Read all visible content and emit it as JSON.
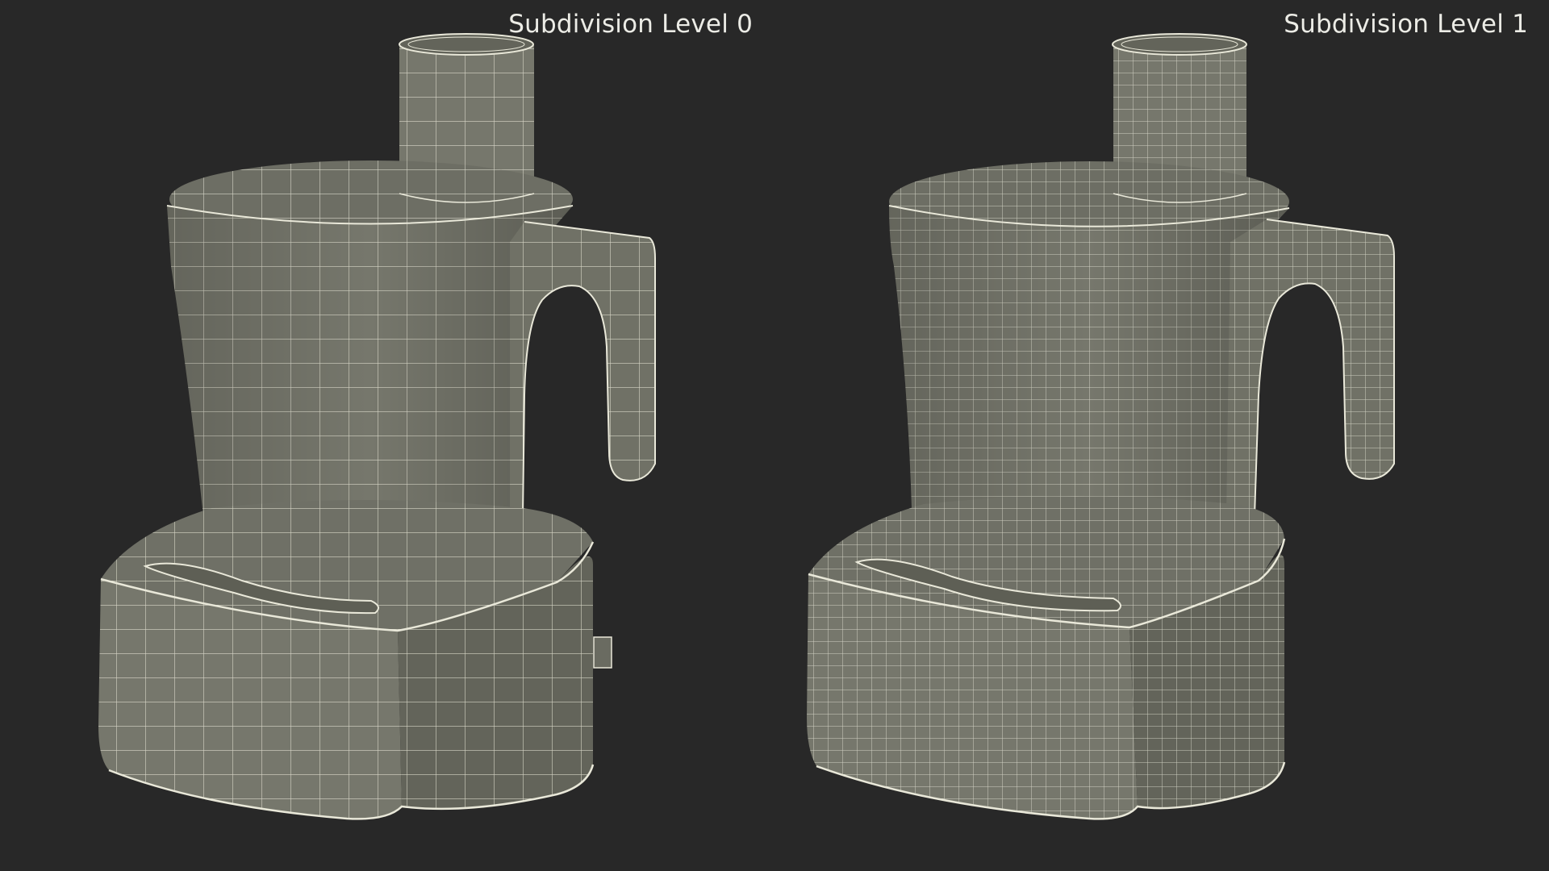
{
  "panels": [
    {
      "label": "Subdivision Level 0"
    },
    {
      "label": "Subdivision Level 1"
    }
  ],
  "colors": {
    "background": "#282828",
    "surface": "#76776c",
    "surface_dark": "#63645a",
    "wire": "#e9e8d9",
    "label_text": "#ecece6"
  }
}
